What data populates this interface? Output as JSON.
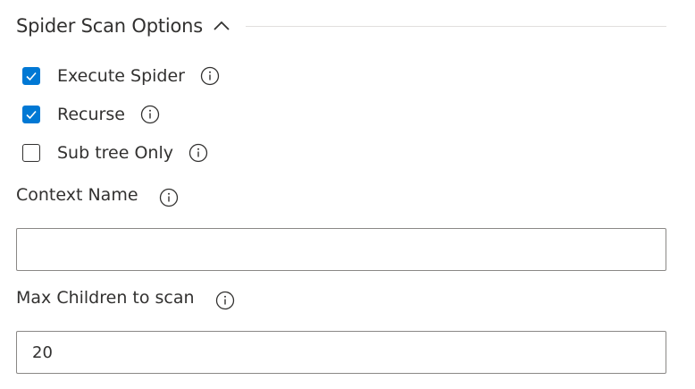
{
  "section": {
    "title": "Spider Scan Options",
    "expanded": true,
    "chevron_icon": "chevron-up-icon"
  },
  "options": [
    {
      "label": "Execute Spider",
      "checked": true,
      "info_icon": "info-icon"
    },
    {
      "label": "Recurse",
      "checked": true,
      "info_icon": "info-icon"
    },
    {
      "label": "Sub tree Only",
      "checked": false,
      "info_icon": "info-icon"
    }
  ],
  "context_name": {
    "label": "Context Name",
    "value": "",
    "info_icon": "info-icon"
  },
  "max_children": {
    "label": "Max Children to scan",
    "value": "20",
    "info_icon": "info-icon"
  },
  "colors": {
    "accent": "#0078d4",
    "text": "#323130",
    "border": "#8a8886"
  }
}
